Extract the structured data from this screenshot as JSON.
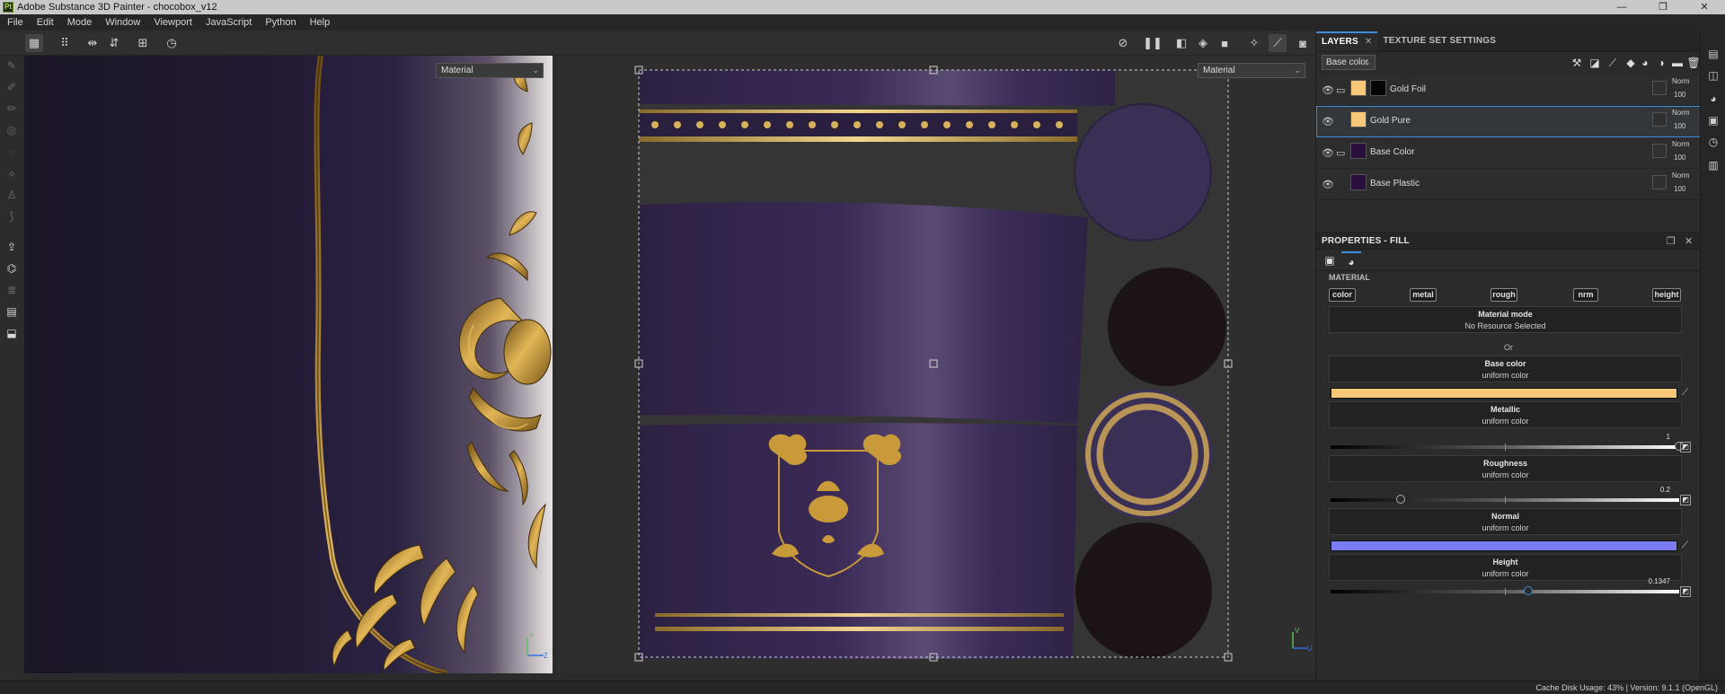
{
  "window": {
    "app_icon": "Pt",
    "title": "Adobe Substance 3D Painter - chocobox_v12",
    "minimize": "—",
    "maximize": "❐",
    "close": "✕"
  },
  "menu": [
    "File",
    "Edit",
    "Mode",
    "Window",
    "Viewport",
    "JavaScript",
    "Python",
    "Help"
  ],
  "viewports": {
    "left_material": "Material",
    "right_material": "Material",
    "axis_y": "Y",
    "axis_z": "Z",
    "axis_v": "V",
    "axis_u": "U"
  },
  "layers_panel": {
    "tabs": [
      {
        "label": "LAYERS",
        "close": "✕"
      },
      {
        "label": "TEXTURE SET SETTINGS"
      }
    ],
    "channel": "Base color",
    "layers": [
      {
        "name": "Gold Foil",
        "blend": "Norm",
        "opacity": "100",
        "color": "#f7c878",
        "has_folder": true,
        "has_mask": true
      },
      {
        "name": "Gold Pure",
        "blend": "Norm",
        "opacity": "100",
        "color": "#f7c878",
        "selected": true
      },
      {
        "name": "Base Color",
        "blend": "Norm",
        "opacity": "100",
        "color": "#2a0f3d",
        "has_folder": true
      },
      {
        "name": "Base Plastic",
        "blend": "Norm",
        "opacity": "100",
        "color": "#2a0f3d"
      }
    ]
  },
  "properties": {
    "title": "PROPERTIES - FILL",
    "section": "MATERIAL",
    "channels": [
      "color",
      "metal",
      "rough",
      "nrm",
      "height"
    ],
    "material_mode": {
      "title": "Material mode",
      "subtitle": "No Resource Selected"
    },
    "or_label": "Or",
    "base_color": {
      "title": "Base color",
      "subtitle": "uniform color",
      "color": "#f7c878"
    },
    "metallic": {
      "title": "Metallic",
      "subtitle": "uniform color",
      "value": "1",
      "fraction": 1.0
    },
    "roughness": {
      "title": "Roughness",
      "subtitle": "uniform color",
      "value": "0.2",
      "fraction": 0.2
    },
    "normal": {
      "title": "Normal",
      "subtitle": "uniform color",
      "color": "#7b7bf2"
    },
    "height": {
      "title": "Height",
      "subtitle": "uniform color",
      "value": "0.1347",
      "fraction": 0.567
    }
  },
  "status": {
    "text": "Cache Disk Usage:   43% | Version: 9.1.1 (OpenGL)"
  },
  "icons": {
    "toolbar": [
      "grid-icon",
      "grid-dense-icon",
      "symmetry-icon",
      "flip-icon",
      "add-icon",
      "history-icon",
      "hide-icon",
      "pause-icon",
      "display-mode-icon",
      "cube-icon",
      "camera-icon",
      "lighting-icon",
      "brush-icon",
      "screenshot-icon"
    ],
    "colors": {
      "accent": "#3b8fd9",
      "gold": "#f7c878",
      "purple": "#2a0f3d"
    }
  }
}
